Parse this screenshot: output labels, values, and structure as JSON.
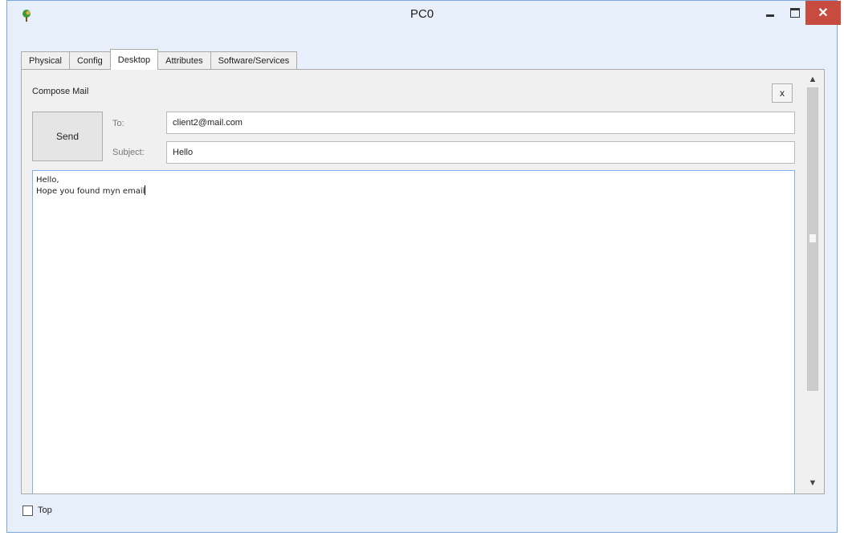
{
  "window": {
    "title": "PC0"
  },
  "tabs": [
    {
      "label": "Physical"
    },
    {
      "label": "Config"
    },
    {
      "label": "Desktop"
    },
    {
      "label": "Attributes"
    },
    {
      "label": "Software/Services"
    }
  ],
  "compose": {
    "title": "Compose Mail",
    "close_label": "x",
    "send_label": "Send",
    "to_label": "To:",
    "to_value": "client2@mail.com",
    "subject_label": "Subject:",
    "subject_value": "Hello",
    "body_lines": [
      "Hello,",
      "Hope you found myn email"
    ]
  },
  "footer": {
    "top_label": "Top",
    "top_checked": false
  },
  "colors": {
    "close_button": "#c74b3e",
    "window_frame": "#e6effa",
    "focus_border": "#7eb4ea"
  }
}
